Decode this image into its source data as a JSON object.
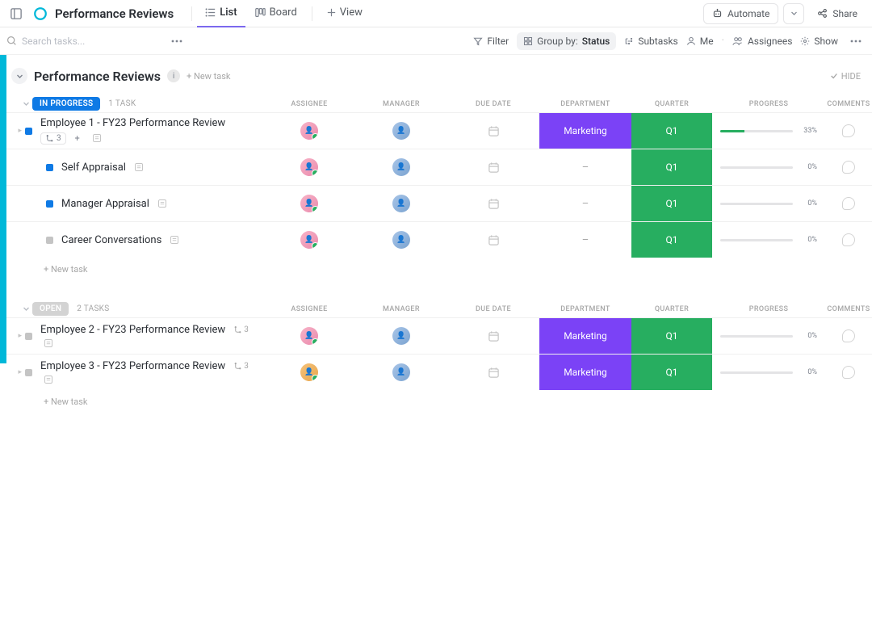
{
  "topbar": {
    "page_title": "Performance Reviews",
    "tabs": [
      {
        "label": "List",
        "icon": "list-icon",
        "active": true
      },
      {
        "label": "Board",
        "icon": "board-icon",
        "active": false
      },
      {
        "label": "View",
        "icon": "plus-icon",
        "active": false
      }
    ],
    "automate": "Automate",
    "share": "Share"
  },
  "toolbar": {
    "search_placeholder": "Search tasks...",
    "filter": "Filter",
    "group_label": "Group by:",
    "group_value": "Status",
    "subtasks": "Subtasks",
    "me": "Me",
    "assignees": "Assignees",
    "show": "Show"
  },
  "section": {
    "title": "Performance Reviews",
    "new_task": "+ New task",
    "hide": "HIDE"
  },
  "columns": {
    "assignee": "ASSIGNEE",
    "manager": "MANAGER",
    "due": "DUE DATE",
    "dept": "DEPARTMENT",
    "quarter": "QUARTER",
    "progress": "PROGRESS",
    "comments": "COMMENTS"
  },
  "groups": [
    {
      "status_label": "IN PROGRESS",
      "status_class": "status-ip",
      "count_label": "1 TASK",
      "rows": [
        {
          "name": "Employee 1 - FY23 Performance Review",
          "indent": 0,
          "sq": "sq-ip",
          "has_tri": true,
          "sub_count": "3",
          "show_meta_chip": true,
          "dept": "Marketing",
          "quarter": "Q1",
          "progress_pct": 33,
          "progress_label": "33%",
          "assignee_av": "av-pink",
          "manager_av": "av-blue"
        },
        {
          "name": "Self Appraisal",
          "indent": 1,
          "sq": "sq-ip",
          "dept_dash": "–",
          "quarter": "Q1",
          "progress_pct": 0,
          "progress_label": "0%",
          "assignee_av": "av-pink",
          "manager_av": "av-blue"
        },
        {
          "name": "Manager Appraisal",
          "indent": 1,
          "sq": "sq-ip",
          "dept_dash": "–",
          "quarter": "Q1",
          "progress_pct": 0,
          "progress_label": "0%",
          "assignee_av": "av-pink",
          "manager_av": "av-blue"
        },
        {
          "name": "Career Conversations",
          "indent": 1,
          "sq": "sq-grey",
          "dept_dash": "–",
          "quarter": "Q1",
          "progress_pct": 0,
          "progress_label": "0%",
          "assignee_av": "av-pink",
          "manager_av": "av-blue"
        }
      ],
      "footer_new": "+ New task"
    },
    {
      "status_label": "OPEN",
      "status_class": "status-open",
      "count_label": "2 TASKS",
      "rows": [
        {
          "name": "Employee 2 - FY23 Performance Review",
          "indent": 0,
          "sq": "sq-grey",
          "has_tri": true,
          "inline_cnt": "3",
          "show_meta_note": true,
          "dept": "Marketing",
          "quarter": "Q1",
          "progress_pct": 0,
          "progress_label": "0%",
          "assignee_av": "av-pink",
          "manager_av": "av-blue"
        },
        {
          "name": "Employee 3 - FY23 Performance Review",
          "indent": 0,
          "sq": "sq-grey",
          "has_tri": true,
          "inline_cnt": "3",
          "show_meta_note": true,
          "dept": "Marketing",
          "quarter": "Q1",
          "progress_pct": 0,
          "progress_label": "0%",
          "assignee_av": "av-orange",
          "manager_av": "av-blue"
        }
      ],
      "footer_new": "+ New task"
    }
  ],
  "colors": {
    "accent": "#7b68ee",
    "dept_bg": "#7b42f6",
    "quarter_bg": "#27ae60",
    "in_progress": "#0f7ae5"
  }
}
